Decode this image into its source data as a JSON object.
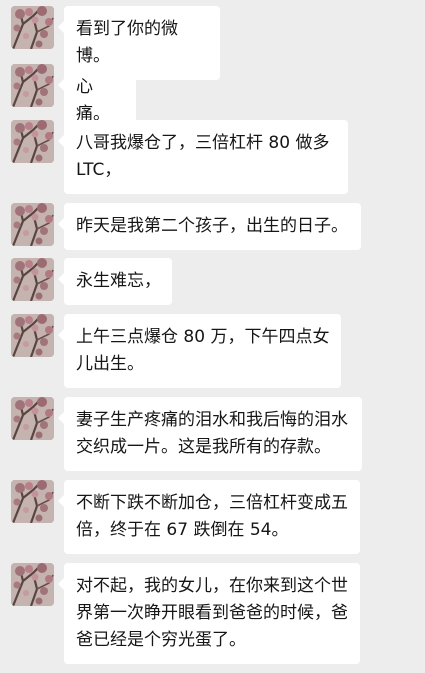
{
  "chat": {
    "messages": [
      {
        "text": "看到了你的微博。"
      },
      {
        "text": "心痛。"
      },
      {
        "text": "八哥我爆仓了，三倍杠杆 80 做多 LTC，"
      },
      {
        "text": "昨天是我第二个孩子，出生的日子。"
      },
      {
        "text": "永生难忘，"
      },
      {
        "text": "上午三点爆仓 80 万，下午四点女儿出生。"
      },
      {
        "text": "妻子生产疼痛的泪水和我后悔的泪水交织成一片。这是我所有的存款。"
      },
      {
        "text": "不断下跌不断加仓，三倍杠杆变成五倍，终于在 67 跌倒在 54。"
      },
      {
        "text": "对不起，我的女儿，在你来到这个世界第一次睁开眼看到爸爸的时候，爸爸已经是个穷光蛋了。"
      }
    ]
  },
  "colors": {
    "background": "#ededed",
    "bubble": "#ffffff",
    "text": "#161616"
  },
  "icons": {
    "avatar": "avatar-blossom-photo"
  }
}
